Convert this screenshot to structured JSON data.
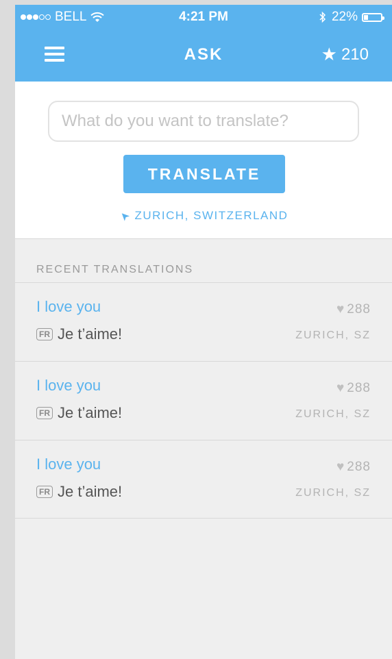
{
  "status_bar": {
    "carrier": "BELL",
    "signal_bars_filled": 3,
    "signal_bars_total": 5,
    "time": "4:21 PM",
    "battery": "22%",
    "bluetooth_icon": "bluetooth-icon",
    "wifi_icon": "wifi-icon"
  },
  "nav": {
    "title": "ASK",
    "menu_icon": "hamburger-menu-icon",
    "star_icon": "★",
    "stars": "210"
  },
  "ask": {
    "placeholder": "What do you want to translate?",
    "value": "",
    "button_label": "TRANSLATE",
    "location_icon": "➤",
    "location": "ZURICH, SWITZERLAND"
  },
  "recent": {
    "section_title": "RECENT TRANSLATIONS",
    "heart_icon": "♥",
    "items": [
      {
        "source": "I love you",
        "likes": "288",
        "lang": "FR",
        "translation": "Je t’aime!",
        "place": "ZURICH, SZ"
      },
      {
        "source": "I love you",
        "likes": "288",
        "lang": "FR",
        "translation": "Je t’aime!",
        "place": "ZURICH, SZ"
      },
      {
        "source": "I love you",
        "likes": "288",
        "lang": "FR",
        "translation": "Je t’aime!",
        "place": "ZURICH, SZ"
      }
    ]
  },
  "colors": {
    "accent": "#5ab3ee",
    "background": "#efefef",
    "muted_text": "#b4b4b4"
  }
}
